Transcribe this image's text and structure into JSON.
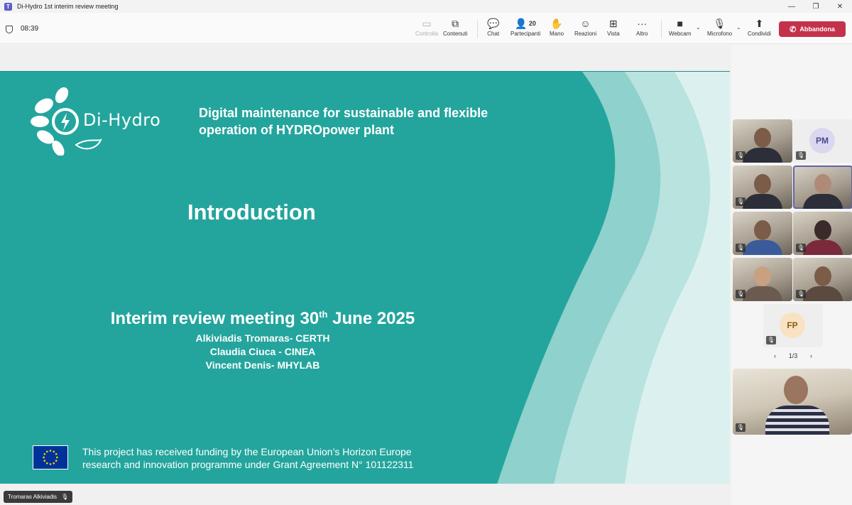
{
  "window": {
    "title": "Di-Hydro 1st interim review meeting",
    "controls": [
      "—",
      "❐",
      "✕"
    ]
  },
  "toolbar": {
    "timer": "08:39",
    "items": [
      {
        "label": "Controlla",
        "icon": "screen-control-icon",
        "glyph": "▭"
      },
      {
        "label": "Contenuti",
        "icon": "share-content-icon",
        "glyph": "⧉"
      },
      {
        "label": "Chat",
        "icon": "chat-icon",
        "glyph": "💬"
      },
      {
        "label": "Partecipanti",
        "icon": "people-icon",
        "glyph": "👤",
        "count": "20"
      },
      {
        "label": "Mano",
        "icon": "raise-hand-icon",
        "glyph": "✋"
      },
      {
        "label": "Reazioni",
        "icon": "reactions-icon",
        "glyph": "☺"
      },
      {
        "label": "Vista",
        "icon": "view-icon",
        "glyph": "⊞"
      },
      {
        "label": "Altro",
        "icon": "more-icon",
        "glyph": "···"
      },
      {
        "label": "Webcam",
        "icon": "camera-icon",
        "glyph": "■"
      },
      {
        "label": "Microfono",
        "icon": "mic-off-icon",
        "glyph": "🎙"
      },
      {
        "label": "Condividi",
        "icon": "share-icon",
        "glyph": "⬆"
      }
    ],
    "leave_label": "Abbandona",
    "leave_color": "#c4314b"
  },
  "slide": {
    "logo_text": "Di-Hydro",
    "tagline_line1": "Digital maintenance for sustainable and flexible",
    "tagline_line2": "operation of HYDROpower plant",
    "heading": "Introduction",
    "meeting_prefix": "Interim review meeting 30",
    "meeting_sup": "th",
    "meeting_suffix": " June 2025",
    "authors": [
      "Alkiviadis Tromaras- CERTH",
      "Claudia Ciuca - CINEA",
      "Vincent Denis- MHYLAB"
    ],
    "funding_line1": "This project has received funding by the European Union’s Horizon Europe",
    "funding_line2": "research and innovation programme under Grant Agreement N° 101122311",
    "background_color": "#23a59d"
  },
  "presenter_tag": "Tromaras Alkiviadis",
  "participants": {
    "avatars": [
      {
        "initials": "PM",
        "bg": "#d9d8f0",
        "fg": "#4b4a8a"
      },
      {
        "initials": "FP",
        "bg": "#f8e2c2",
        "fg": "#8a5a1a"
      }
    ],
    "pager": {
      "prev": "‹",
      "page": "1/3",
      "next": "›"
    }
  }
}
